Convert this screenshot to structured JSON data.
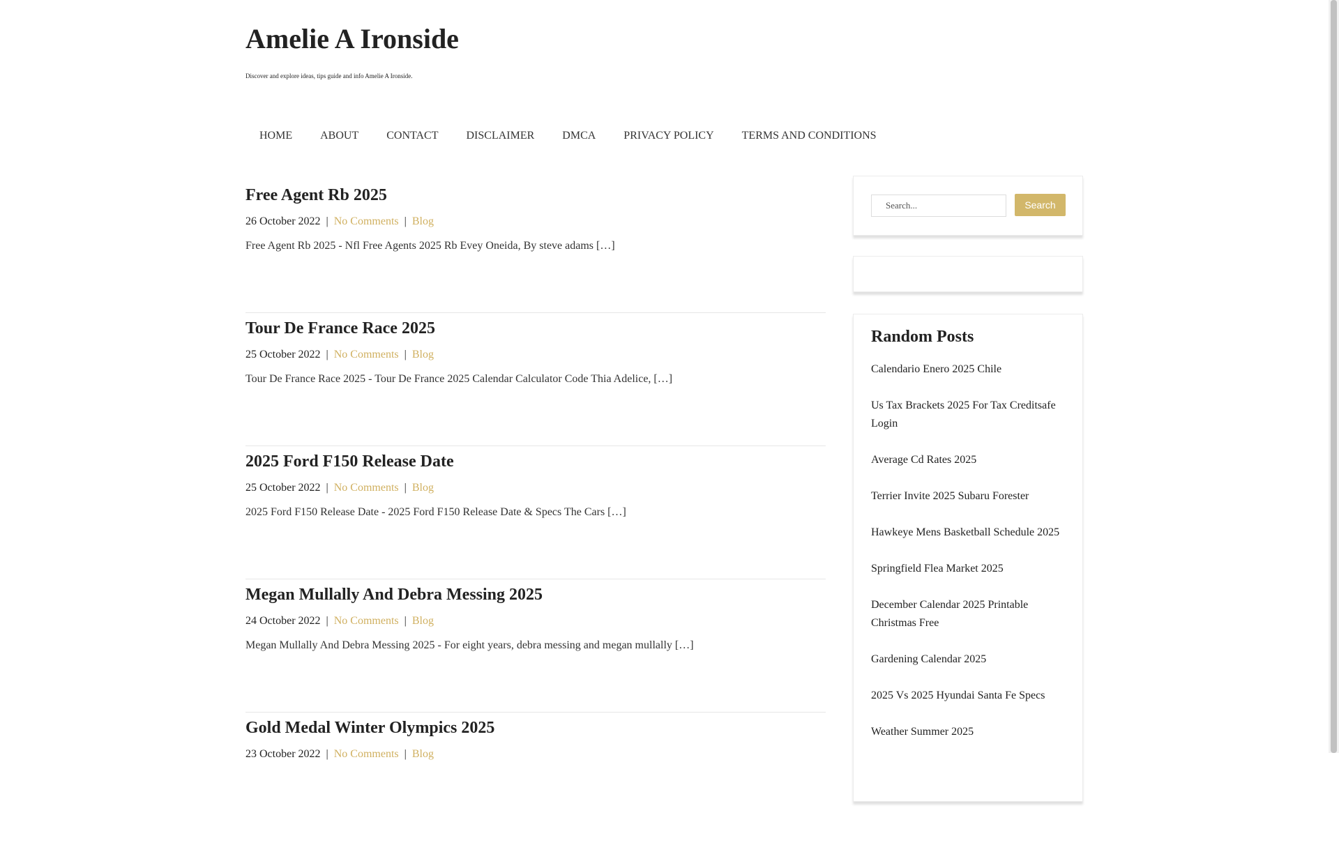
{
  "site": {
    "title": "Amelie A Ironside",
    "description": "Discover and explore ideas, tips guide and info Amelie A Ironside."
  },
  "nav": [
    "HOME",
    "ABOUT",
    "CONTACT",
    "DISCLAIMER",
    "DMCA",
    "PRIVACY POLICY",
    "TERMS AND CONDITIONS"
  ],
  "posts": [
    {
      "title": "Free Agent Rb 2025",
      "date": "26 October 2022",
      "comments": "No Comments",
      "category": "Blog",
      "excerpt": "Free Agent Rb 2025 - Nfl Free Agents 2025 Rb Evey Oneida, By steve adams […]"
    },
    {
      "title": "Tour De France Race 2025",
      "date": "25 October 2022",
      "comments": "No Comments",
      "category": "Blog",
      "excerpt": "Tour De France Race 2025 - Tour De France 2025 Calendar Calculator Code Thia Adelice, […]"
    },
    {
      "title": "2025 Ford F150 Release Date",
      "date": "25 October 2022",
      "comments": "No Comments",
      "category": "Blog",
      "excerpt": "2025 Ford F150 Release Date - 2025 Ford F150 Release Date & Specs The Cars […]"
    },
    {
      "title": "Megan Mullally And Debra Messing 2025",
      "date": "24 October 2022",
      "comments": "No Comments",
      "category": "Blog",
      "excerpt": "Megan Mullally And Debra Messing 2025 - For eight years, debra messing and megan mullally […]"
    },
    {
      "title": "Gold Medal Winter Olympics 2025",
      "date": "23 October 2022",
      "comments": "No Comments",
      "category": "Blog",
      "excerpt": ""
    }
  ],
  "meta_separator": "|",
  "search": {
    "placeholder": "Search...",
    "button": "Search"
  },
  "random_posts": {
    "title": "Random Posts",
    "items": [
      "Calendario Enero 2025 Chile",
      "Us Tax Brackets 2025 For Tax Creditsafe Login",
      "Average Cd Rates 2025",
      "Terrier Invite 2025 Subaru Forester",
      "Hawkeye Mens Basketball Schedule 2025",
      "Springfield Flea Market 2025",
      "December Calendar 2025 Printable Christmas Free",
      "Gardening Calendar 2025",
      "2025 Vs 2025 Hyundai Santa Fe Specs",
      "Weather Summer 2025"
    ]
  },
  "colors": {
    "accent": "#d0b060",
    "button": "#d2b76a",
    "text": "#222222"
  }
}
